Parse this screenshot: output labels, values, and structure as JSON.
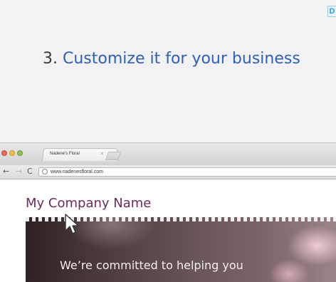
{
  "slide": {
    "badge_text": "D",
    "step_number": "3.",
    "heading": "Customize it for your business"
  },
  "browser": {
    "tab_title": "Nadene's Floral",
    "tab_close": "×",
    "back_glyph": "←",
    "forward_glyph": "→",
    "reload_glyph": "C",
    "url": "www.nadenesfloral.com"
  },
  "page": {
    "company_name": "My Company Name",
    "hero_tagline": "We’re committed to helping you"
  },
  "colors": {
    "heading_blue": "#2f5fb8",
    "company_purple": "#6b2c5c"
  }
}
